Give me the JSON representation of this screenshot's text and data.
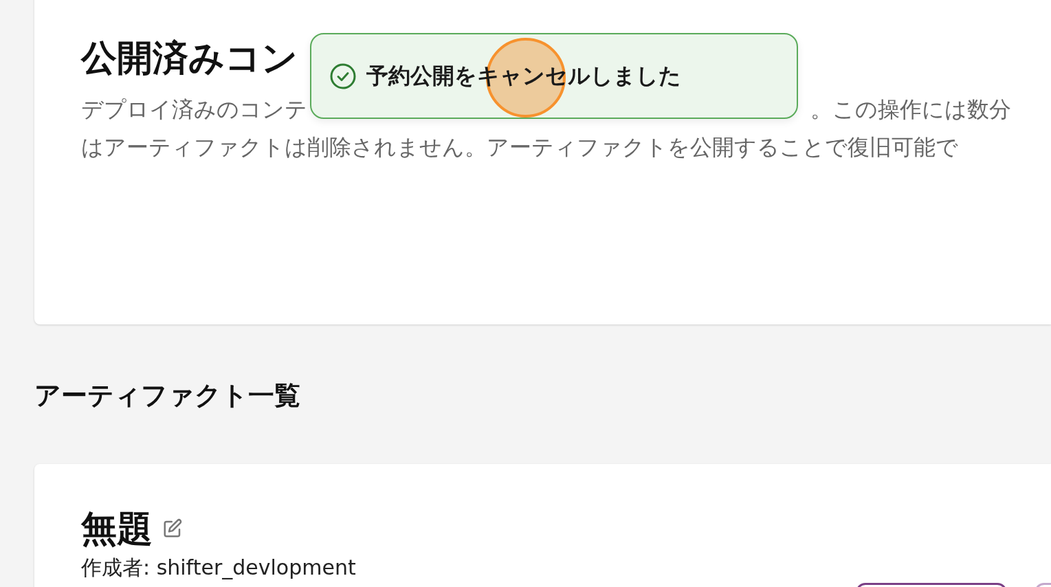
{
  "overview_card": {
    "title": "公開済みコン",
    "description_lines": [
      [
        "デプロイ済みのコンテ",
        "。この操作には数分"
      ],
      [
        "はアーティファクトは削除されません。アーティファクトを公開することで復旧可能で"
      ]
    ]
  },
  "toast": {
    "kind": "success",
    "message": "予約公開をキャンセルしました"
  },
  "artifacts_section": {
    "heading": "アーティファクト一覧",
    "artifacts": [
      {
        "title": "無題",
        "author": "作成者: shifter_devlopment"
      }
    ]
  }
}
